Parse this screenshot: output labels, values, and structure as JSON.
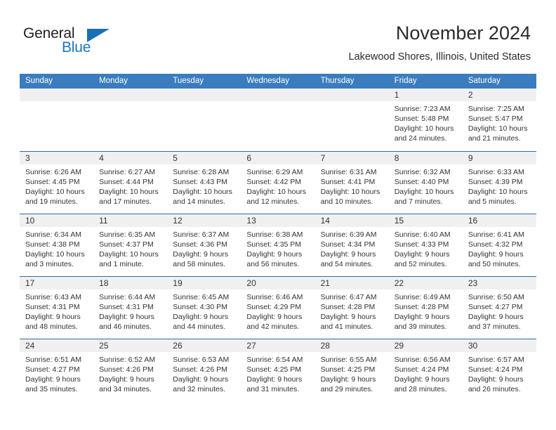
{
  "brand": {
    "name_part1": "General",
    "name_part2": "Blue",
    "logo_icon": "triangle-logo-icon",
    "accent_color": "#1b75bb"
  },
  "header": {
    "month_title": "November 2024",
    "location": "Lakewood Shores, Illinois, United States"
  },
  "calendar": {
    "header_bg_color": "#3a7cbe",
    "row_divider_color": "#2e6ca4",
    "datenum_band_color": "#f0f0f0",
    "day_names": [
      "Sunday",
      "Monday",
      "Tuesday",
      "Wednesday",
      "Thursday",
      "Friday",
      "Saturday"
    ],
    "weeks": [
      [
        {
          "day": "",
          "sunrise": "",
          "sunset": "",
          "daylight1": "",
          "daylight2": ""
        },
        {
          "day": "",
          "sunrise": "",
          "sunset": "",
          "daylight1": "",
          "daylight2": ""
        },
        {
          "day": "",
          "sunrise": "",
          "sunset": "",
          "daylight1": "",
          "daylight2": ""
        },
        {
          "day": "",
          "sunrise": "",
          "sunset": "",
          "daylight1": "",
          "daylight2": ""
        },
        {
          "day": "",
          "sunrise": "",
          "sunset": "",
          "daylight1": "",
          "daylight2": ""
        },
        {
          "day": "1",
          "sunrise": "Sunrise: 7:23 AM",
          "sunset": "Sunset: 5:48 PM",
          "daylight1": "Daylight: 10 hours",
          "daylight2": "and 24 minutes."
        },
        {
          "day": "2",
          "sunrise": "Sunrise: 7:25 AM",
          "sunset": "Sunset: 5:47 PM",
          "daylight1": "Daylight: 10 hours",
          "daylight2": "and 21 minutes."
        }
      ],
      [
        {
          "day": "3",
          "sunrise": "Sunrise: 6:26 AM",
          "sunset": "Sunset: 4:45 PM",
          "daylight1": "Daylight: 10 hours",
          "daylight2": "and 19 minutes."
        },
        {
          "day": "4",
          "sunrise": "Sunrise: 6:27 AM",
          "sunset": "Sunset: 4:44 PM",
          "daylight1": "Daylight: 10 hours",
          "daylight2": "and 17 minutes."
        },
        {
          "day": "5",
          "sunrise": "Sunrise: 6:28 AM",
          "sunset": "Sunset: 4:43 PM",
          "daylight1": "Daylight: 10 hours",
          "daylight2": "and 14 minutes."
        },
        {
          "day": "6",
          "sunrise": "Sunrise: 6:29 AM",
          "sunset": "Sunset: 4:42 PM",
          "daylight1": "Daylight: 10 hours",
          "daylight2": "and 12 minutes."
        },
        {
          "day": "7",
          "sunrise": "Sunrise: 6:31 AM",
          "sunset": "Sunset: 4:41 PM",
          "daylight1": "Daylight: 10 hours",
          "daylight2": "and 10 minutes."
        },
        {
          "day": "8",
          "sunrise": "Sunrise: 6:32 AM",
          "sunset": "Sunset: 4:40 PM",
          "daylight1": "Daylight: 10 hours",
          "daylight2": "and 7 minutes."
        },
        {
          "day": "9",
          "sunrise": "Sunrise: 6:33 AM",
          "sunset": "Sunset: 4:39 PM",
          "daylight1": "Daylight: 10 hours",
          "daylight2": "and 5 minutes."
        }
      ],
      [
        {
          "day": "10",
          "sunrise": "Sunrise: 6:34 AM",
          "sunset": "Sunset: 4:38 PM",
          "daylight1": "Daylight: 10 hours",
          "daylight2": "and 3 minutes."
        },
        {
          "day": "11",
          "sunrise": "Sunrise: 6:35 AM",
          "sunset": "Sunset: 4:37 PM",
          "daylight1": "Daylight: 10 hours",
          "daylight2": "and 1 minute."
        },
        {
          "day": "12",
          "sunrise": "Sunrise: 6:37 AM",
          "sunset": "Sunset: 4:36 PM",
          "daylight1": "Daylight: 9 hours",
          "daylight2": "and 58 minutes."
        },
        {
          "day": "13",
          "sunrise": "Sunrise: 6:38 AM",
          "sunset": "Sunset: 4:35 PM",
          "daylight1": "Daylight: 9 hours",
          "daylight2": "and 56 minutes."
        },
        {
          "day": "14",
          "sunrise": "Sunrise: 6:39 AM",
          "sunset": "Sunset: 4:34 PM",
          "daylight1": "Daylight: 9 hours",
          "daylight2": "and 54 minutes."
        },
        {
          "day": "15",
          "sunrise": "Sunrise: 6:40 AM",
          "sunset": "Sunset: 4:33 PM",
          "daylight1": "Daylight: 9 hours",
          "daylight2": "and 52 minutes."
        },
        {
          "day": "16",
          "sunrise": "Sunrise: 6:41 AM",
          "sunset": "Sunset: 4:32 PM",
          "daylight1": "Daylight: 9 hours",
          "daylight2": "and 50 minutes."
        }
      ],
      [
        {
          "day": "17",
          "sunrise": "Sunrise: 6:43 AM",
          "sunset": "Sunset: 4:31 PM",
          "daylight1": "Daylight: 9 hours",
          "daylight2": "and 48 minutes."
        },
        {
          "day": "18",
          "sunrise": "Sunrise: 6:44 AM",
          "sunset": "Sunset: 4:31 PM",
          "daylight1": "Daylight: 9 hours",
          "daylight2": "and 46 minutes."
        },
        {
          "day": "19",
          "sunrise": "Sunrise: 6:45 AM",
          "sunset": "Sunset: 4:30 PM",
          "daylight1": "Daylight: 9 hours",
          "daylight2": "and 44 minutes."
        },
        {
          "day": "20",
          "sunrise": "Sunrise: 6:46 AM",
          "sunset": "Sunset: 4:29 PM",
          "daylight1": "Daylight: 9 hours",
          "daylight2": "and 42 minutes."
        },
        {
          "day": "21",
          "sunrise": "Sunrise: 6:47 AM",
          "sunset": "Sunset: 4:28 PM",
          "daylight1": "Daylight: 9 hours",
          "daylight2": "and 41 minutes."
        },
        {
          "day": "22",
          "sunrise": "Sunrise: 6:49 AM",
          "sunset": "Sunset: 4:28 PM",
          "daylight1": "Daylight: 9 hours",
          "daylight2": "and 39 minutes."
        },
        {
          "day": "23",
          "sunrise": "Sunrise: 6:50 AM",
          "sunset": "Sunset: 4:27 PM",
          "daylight1": "Daylight: 9 hours",
          "daylight2": "and 37 minutes."
        }
      ],
      [
        {
          "day": "24",
          "sunrise": "Sunrise: 6:51 AM",
          "sunset": "Sunset: 4:27 PM",
          "daylight1": "Daylight: 9 hours",
          "daylight2": "and 35 minutes."
        },
        {
          "day": "25",
          "sunrise": "Sunrise: 6:52 AM",
          "sunset": "Sunset: 4:26 PM",
          "daylight1": "Daylight: 9 hours",
          "daylight2": "and 34 minutes."
        },
        {
          "day": "26",
          "sunrise": "Sunrise: 6:53 AM",
          "sunset": "Sunset: 4:26 PM",
          "daylight1": "Daylight: 9 hours",
          "daylight2": "and 32 minutes."
        },
        {
          "day": "27",
          "sunrise": "Sunrise: 6:54 AM",
          "sunset": "Sunset: 4:25 PM",
          "daylight1": "Daylight: 9 hours",
          "daylight2": "and 31 minutes."
        },
        {
          "day": "28",
          "sunrise": "Sunrise: 6:55 AM",
          "sunset": "Sunset: 4:25 PM",
          "daylight1": "Daylight: 9 hours",
          "daylight2": "and 29 minutes."
        },
        {
          "day": "29",
          "sunrise": "Sunrise: 6:56 AM",
          "sunset": "Sunset: 4:24 PM",
          "daylight1": "Daylight: 9 hours",
          "daylight2": "and 28 minutes."
        },
        {
          "day": "30",
          "sunrise": "Sunrise: 6:57 AM",
          "sunset": "Sunset: 4:24 PM",
          "daylight1": "Daylight: 9 hours",
          "daylight2": "and 26 minutes."
        }
      ]
    ]
  }
}
